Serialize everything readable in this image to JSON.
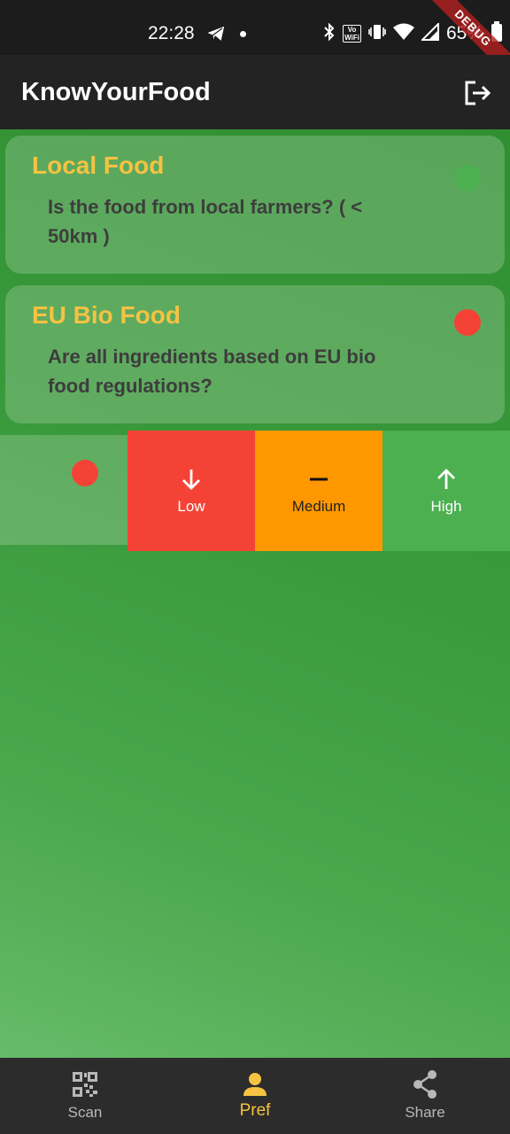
{
  "status_bar": {
    "time": "22:28",
    "battery": "65%",
    "vowifi_top": "Vo",
    "vowifi_bottom": "WiFi",
    "debug_label": "DEBUG"
  },
  "app_bar": {
    "title": "KnowYourFood",
    "action_icon": "logout-icon"
  },
  "preferences": [
    {
      "title": "Local Food",
      "question": "Is the food from local farmers? ( < 50km )",
      "status_color": "#4caf50"
    },
    {
      "title": "EU Bio Food",
      "question": "Are all ingredients based on EU bio food regulations?",
      "status_color": "#f44336"
    }
  ],
  "swipe_row": {
    "status_color": "#f44336",
    "actions": [
      {
        "label": "Low",
        "icon": "arrow-down-icon",
        "color": "#f44336"
      },
      {
        "label": "Medium",
        "icon": "minus-icon",
        "color": "#ff9800"
      },
      {
        "label": "High",
        "icon": "arrow-up-icon",
        "color": "#4caf50"
      }
    ]
  },
  "bottom_nav": {
    "items": [
      {
        "label": "Scan",
        "icon": "qr-code-icon",
        "active": false
      },
      {
        "label": "Pref",
        "icon": "person-icon",
        "active": true
      },
      {
        "label": "Share",
        "icon": "share-icon",
        "active": false
      }
    ]
  },
  "colors": {
    "accent": "#f5c242",
    "background": "#3a9a3c"
  }
}
